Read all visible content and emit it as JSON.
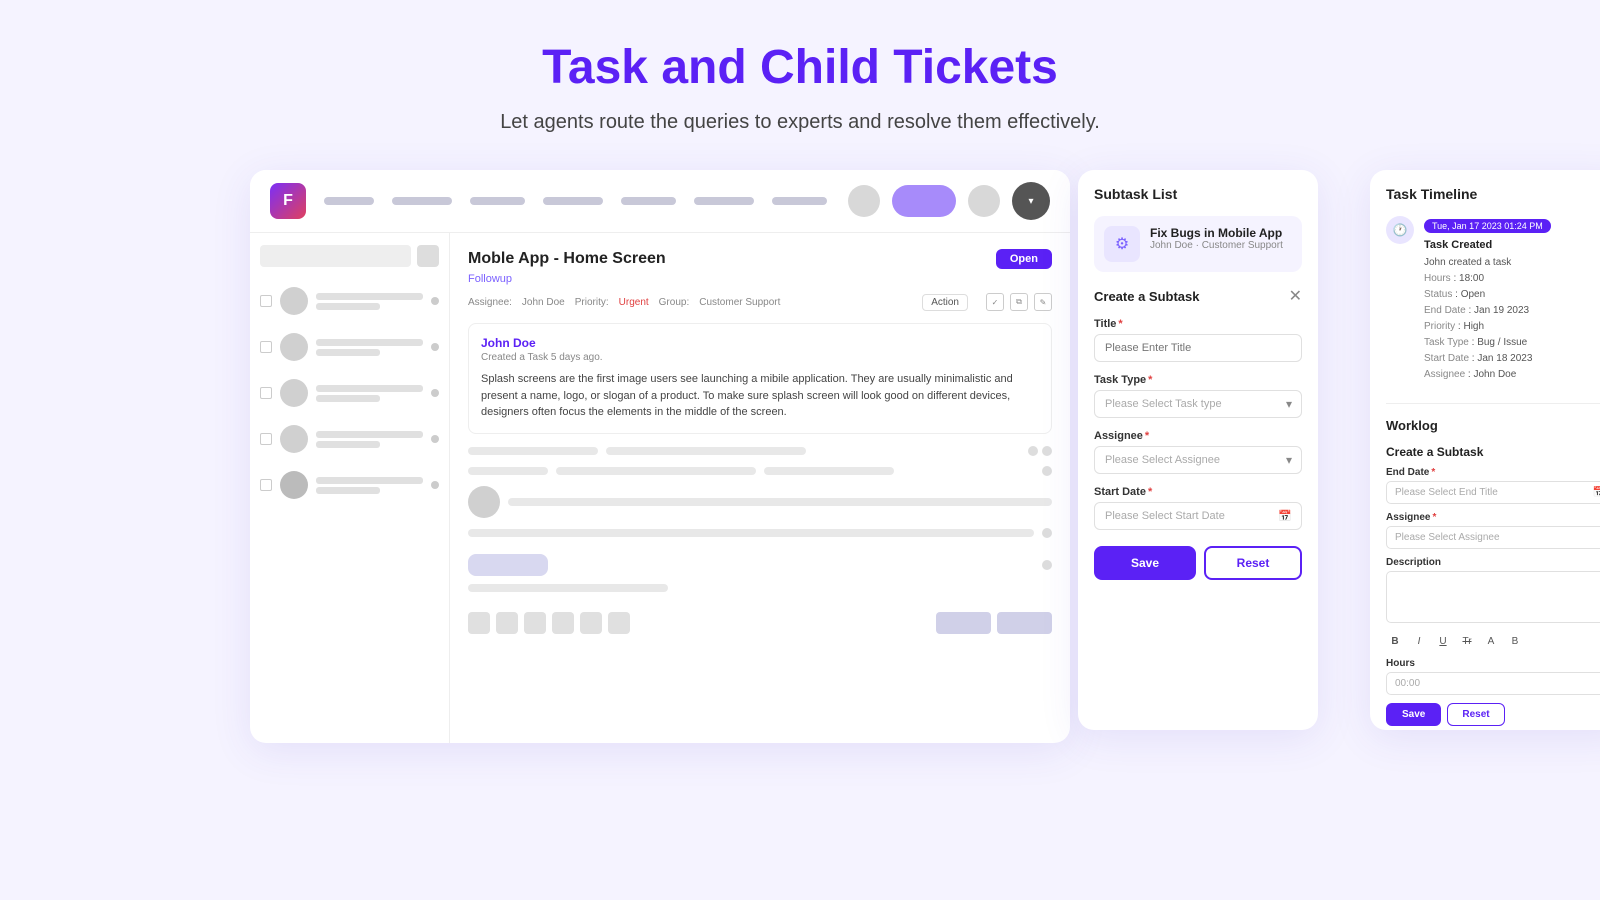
{
  "header": {
    "title": "Task and Child Tickets",
    "subtitle": "Let agents route the queries to experts and resolve them effectively."
  },
  "navbar": {
    "logo_text": "F",
    "nav_items": [
      "",
      "",
      "",
      "",
      "",
      "",
      ""
    ],
    "nav_widths": [
      50,
      60,
      55,
      60,
      55,
      60,
      55
    ]
  },
  "ticket": {
    "title": "Moble App - Home Screen",
    "tag": "Followup",
    "status": "Open",
    "assignee_label": "Assignee:",
    "assignee": "John Doe",
    "priority_label": "Priority:",
    "priority": "Urgent",
    "group_label": "Group:",
    "group": "Customer Support",
    "action_label": "Action",
    "comment_author": "John Doe",
    "comment_meta": "Created a Task 5 days ago.",
    "comment_text": "Splash screens are the first image users see launching a mibile application. They are usually minimalistic and present a name, logo, or slogan of a product. To make sure splash screen will look good on different devices, designers often focus the elements in the middle of the screen."
  },
  "subtask_list": {
    "title": "Subtask List",
    "item": {
      "icon": "⚙",
      "title": "Fix Bugs in Mobile App",
      "sub": "John Doe · Customer Support"
    }
  },
  "create_subtask": {
    "title": "Create a Subtask",
    "title_label": "Title",
    "title_placeholder": "Please Enter Title",
    "task_type_label": "Task Type",
    "task_type_placeholder": "Please Select Task type",
    "assignee_label": "Assignee",
    "assignee_placeholder": "Please Select Assignee",
    "start_date_label": "Start Date",
    "start_date_placeholder": "Please Select Start Date",
    "save_label": "Save",
    "reset_label": "Reset"
  },
  "task_timeline": {
    "title": "Task Timeline",
    "date_badge": "Tue, Jan 17 2023  01:24 PM",
    "event_title": "Task Created",
    "creator_line": "John created a task",
    "hours_label": "Hours",
    "hours_value": "18:00",
    "status_label": "Status",
    "status_value": "Open",
    "end_date_label": "End Date",
    "end_date_value": "Jan 19 2023",
    "priority_label": "Priority",
    "priority_value": "High",
    "task_type_label": "Task Type",
    "task_type_value": "Bug / Issue",
    "start_date_label": "Start Date",
    "start_date_value": "Jan 18 2023",
    "assignee_label": "Assignee",
    "assignee_value": "John Doe"
  },
  "worklog": {
    "title": "Worklog",
    "form_title": "Create a Subtask",
    "end_date_label": "End Date",
    "end_date_placeholder": "Please Select End Title",
    "assignee_label": "Assignee",
    "assignee_placeholder": "Please Select Assignee",
    "description_label": "Description",
    "hours_label": "Hours",
    "hours_value": "00:00",
    "save_label": "Save",
    "reset_label": "Reset",
    "editor_buttons": [
      "B",
      "I",
      "U",
      "Tr",
      "A",
      "B"
    ]
  }
}
